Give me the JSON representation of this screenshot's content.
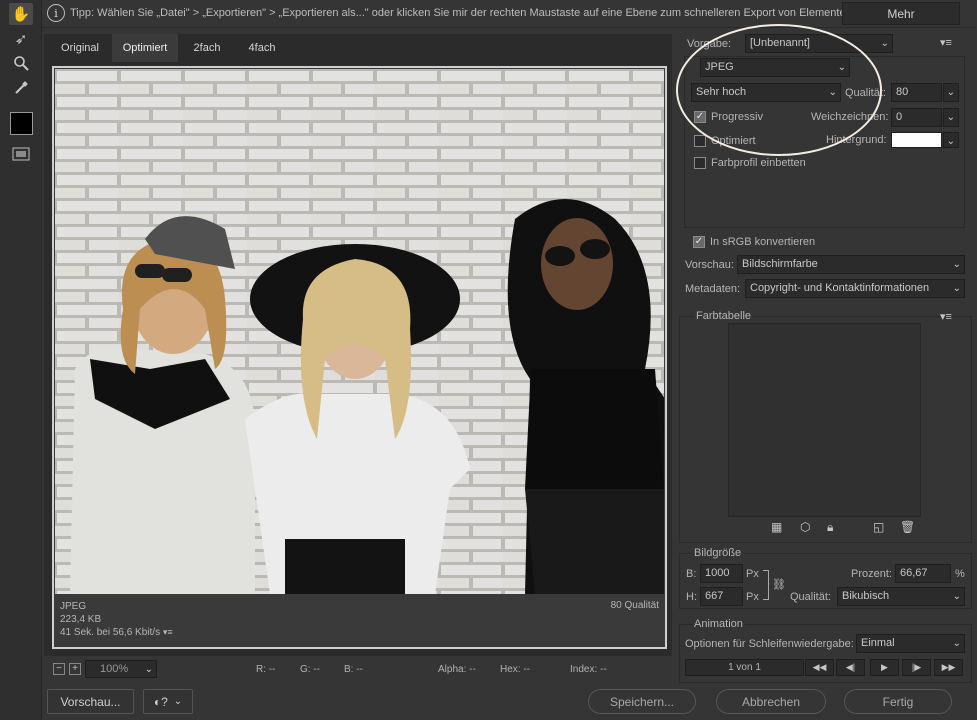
{
  "tools": {
    "hand": "hand-icon",
    "slice": "slice-select-icon",
    "zoom": "zoom-icon",
    "eyedropper": "eyedropper-icon",
    "swatch_color": "#000000",
    "toggle": "toggle-slices-icon"
  },
  "tipbar": {
    "icon": "i",
    "text": "Tipp: Wählen Sie „Datei\" > „Exportieren\" > „Exportieren als...\" oder klicken Sie mir der rechten Maustaste auf eine Ebene zum schnelleren Export von Elementen",
    "more_label": "Mehr"
  },
  "tabs": [
    "Original",
    "Optimiert",
    "2fach",
    "4fach"
  ],
  "image_info": {
    "format": "JPEG",
    "size": "223,4 KB",
    "time": "41 Sek. bei 56,6 Kbit/s",
    "quality": "80 Qualität"
  },
  "statusbar": {
    "zoom": "100%",
    "r": "R: --",
    "g": "G: --",
    "b": "B: --",
    "alpha": "Alpha: --",
    "hex": "Hex: --",
    "index": "Index: --"
  },
  "bottom_left": {
    "preview_label": "Vorschau...",
    "browser_icon": "browser-preview-icon"
  },
  "bottom_right": {
    "save": "Speichern...",
    "cancel": "Abbrechen",
    "done": "Fertig"
  },
  "settings": {
    "preset_label": "Vorgabe:",
    "preset_value": "[Unbenannt]",
    "format": "JPEG",
    "quality_preset": "Sehr hoch",
    "quality_label": "Qualität:",
    "quality_value": "80",
    "progressive": "Progressiv",
    "blur_label": "Weichzeichnen:",
    "blur_value": "0",
    "optimized": "Optimiert",
    "matte_label": "Hintergrund:",
    "matte_color": "#ffffff",
    "embed_profile": "Farbprofil einbetten",
    "srgb": "In sRGB konvertieren",
    "preview_label": "Vorschau:",
    "preview_value": "Bildschirmfarbe",
    "metadata_label": "Metadaten:",
    "metadata_value": "Copyright- und Kontaktinformationen"
  },
  "color_table": {
    "title": "Farbtabelle"
  },
  "image_size": {
    "title": "Bildgröße",
    "w_label": "B:",
    "w_value": "1000",
    "h_label": "H:",
    "h_value": "667",
    "unit": "Px",
    "percent_label": "Prozent:",
    "percent_value": "66,67",
    "percent_unit": "%",
    "quality_label": "Qualität:",
    "quality_value": "Bikubisch"
  },
  "animation": {
    "title": "Animation",
    "loop_label": "Optionen für Schleifenwiedergabe:",
    "loop_value": "Einmal",
    "counter": "1 von 1"
  }
}
